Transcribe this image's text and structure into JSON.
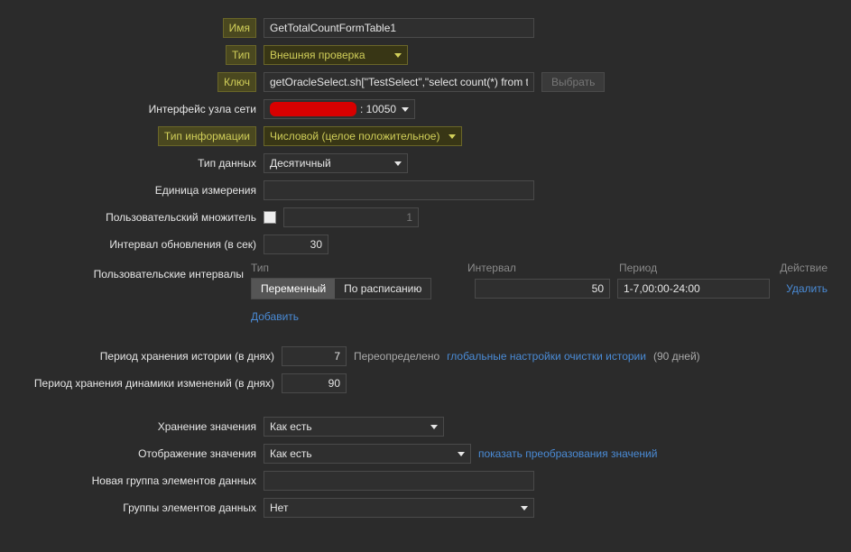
{
  "labels": {
    "name": "Имя",
    "type": "Тип",
    "key": "Ключ",
    "hostInterface": "Интерфейс узла сети",
    "infoType": "Тип информации",
    "dataType": "Тип данных",
    "unit": "Единица измерения",
    "multiplier": "Пользовательский множитель",
    "updateInterval": "Интервал обновления (в сек)",
    "customIntervals": "Пользовательские интервалы",
    "historyPeriod": "Период хранения истории (в днях)",
    "trendsPeriod": "Период хранения динамики изменений (в днях)",
    "valueStore": "Хранение значения",
    "valueShow": "Отображение значения",
    "newAppGroup": "Новая группа элементов данных",
    "appGroups": "Группы элементов данных"
  },
  "values": {
    "name": "GetTotalCountFormTable1",
    "type": "Внешняя проверка",
    "key": "getOracleSelect.sh[\"TestSelect\",\"select count(*) from t",
    "selectBtn": "Выбрать",
    "hostInterfacePort": ": 10050",
    "infoType": "Числовой (целое положительное)",
    "dataType": "Десятичный",
    "unit": "",
    "multiplier": "1",
    "updateInterval": "30",
    "historyDays": "7",
    "overriddenText": "Переопределено",
    "globalSettingsLink": "глобальные настройки очистки истории",
    "globalDays": "(90 дней)",
    "trendsDays": "90",
    "valueStore": "Как есть",
    "valueShow": "Как есть",
    "showMapLink": "показать преобразования значений",
    "appGroupsValue": "Нет"
  },
  "intervals": {
    "head": {
      "type": "Тип",
      "interval": "Интервал",
      "period": "Период",
      "action": "Действие"
    },
    "seg": {
      "flexible": "Переменный",
      "scheduled": "По расписанию"
    },
    "row": {
      "interval": "50",
      "period": "1-7,00:00-24:00",
      "delete": "Удалить"
    },
    "add": "Добавить"
  }
}
